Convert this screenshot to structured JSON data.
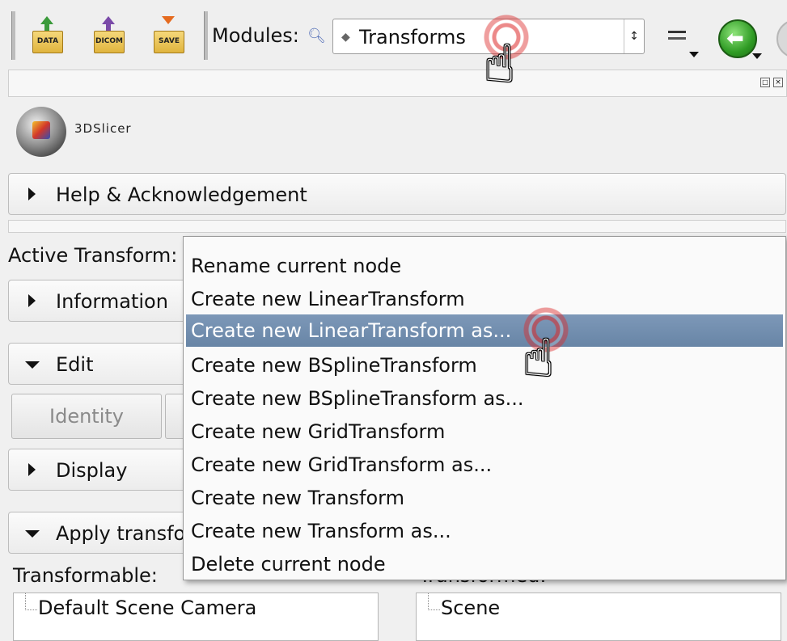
{
  "toolbar": {
    "data_label": "DATA",
    "dicom_label": "DICOM",
    "save_label": "SAVE",
    "modules_label": "Modules:",
    "module_selected": "Transforms"
  },
  "dock": {
    "float_icon": "float-icon",
    "close_icon": "close-icon"
  },
  "app": {
    "logo_text": "3DSlicer"
  },
  "sections": {
    "help": "Help & Acknowledgement",
    "information": "Information",
    "edit": "Edit",
    "display": "Display",
    "apply": "Apply transfo"
  },
  "active_transform_label": "Active Transform:",
  "edit_buttons": {
    "identity": "Identity"
  },
  "transformable_label": "Transformable:",
  "transformed_label": "Transformed:",
  "transformable_items": [
    "Default Scene Camera"
  ],
  "transformed_items": [
    "Scene"
  ],
  "context_menu": {
    "items": [
      "Rename current node",
      "Create new LinearTransform",
      "Create new LinearTransform as...",
      "Create new BSplineTransform",
      "Create new BSplineTransform as...",
      "Create new GridTransform",
      "Create new GridTransform as...",
      "Create new Transform",
      "Create new Transform as...",
      "Delete current node"
    ],
    "highlighted_index": 2
  },
  "colors": {
    "highlight": "#7d98b8",
    "click_ring": "#dc2828",
    "back_button": "#2f9b24"
  }
}
